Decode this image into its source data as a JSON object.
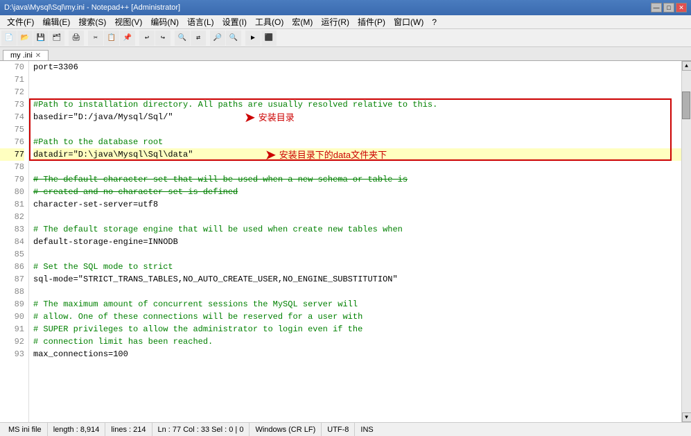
{
  "titlebar": {
    "title": "D:\\java\\Mysql\\Sql\\my.ini - Notepad++ [Administrator]",
    "min_label": "—",
    "max_label": "□",
    "close_label": "✕"
  },
  "menubar": {
    "items": [
      "文件(F)",
      "编辑(E)",
      "搜索(S)",
      "视图(V)",
      "编码(N)",
      "语言(L)",
      "设置(I)",
      "工具(O)",
      "宏(M)",
      "运行(R)",
      "插件(P)",
      "窗口(W)",
      "?"
    ]
  },
  "tabbar": {
    "tabs": [
      {
        "label": "my .ini",
        "active": true
      }
    ]
  },
  "annotations": {
    "basedir_label": "安装目录",
    "datadir_label": "安装目录下的data文件夹下"
  },
  "statusbar": {
    "filetype": "MS ini file",
    "length": "length : 8,914",
    "lines": "lines : 214",
    "position": "Ln : 77   Col : 33   Sel : 0 | 0",
    "eol": "Windows (CR LF)",
    "encoding": "UTF-8",
    "ins": "INS"
  },
  "lines": [
    {
      "num": "70",
      "content": "port=3306",
      "type": "normal"
    },
    {
      "num": "71",
      "content": "",
      "type": "normal"
    },
    {
      "num": "72",
      "content": "",
      "type": "normal"
    },
    {
      "num": "73",
      "content": "#Path to installation directory. All paths are usually resolved relative to this.",
      "type": "comment"
    },
    {
      "num": "74",
      "content": "basedir=\"D:/java/Mysql/Sql/\"",
      "type": "normal"
    },
    {
      "num": "75",
      "content": "",
      "type": "normal"
    },
    {
      "num": "76",
      "content": "#Path to the database root",
      "type": "comment"
    },
    {
      "num": "77",
      "content": "datadir=\"D:\\java\\Mysql\\Sql\\data\"",
      "type": "current"
    },
    {
      "num": "78",
      "content": "",
      "type": "normal"
    },
    {
      "num": "79",
      "content": "# The default character set that will be used when a new schema or table is",
      "type": "comment-struck"
    },
    {
      "num": "80",
      "content": "# created and no character set is defined",
      "type": "comment-struck"
    },
    {
      "num": "81",
      "content": "character-set-server=utf8",
      "type": "normal"
    },
    {
      "num": "82",
      "content": "",
      "type": "normal"
    },
    {
      "num": "83",
      "content": "# The default storage engine that will be used when create new tables when",
      "type": "comment"
    },
    {
      "num": "84",
      "content": "default-storage-engine=INNODB",
      "type": "normal"
    },
    {
      "num": "85",
      "content": "",
      "type": "normal"
    },
    {
      "num": "86",
      "content": "# Set the SQL mode to strict",
      "type": "comment"
    },
    {
      "num": "87",
      "content": "sql-mode=\"STRICT_TRANS_TABLES,NO_AUTO_CREATE_USER,NO_ENGINE_SUBSTITUTION\"",
      "type": "normal"
    },
    {
      "num": "88",
      "content": "",
      "type": "normal"
    },
    {
      "num": "89",
      "content": "# The maximum amount of concurrent sessions the MySQL server will",
      "type": "comment"
    },
    {
      "num": "90",
      "content": "# allow. One of these connections will be reserved for a user with",
      "type": "comment"
    },
    {
      "num": "91",
      "content": "# SUPER privileges to allow the administrator to login even if the",
      "type": "comment"
    },
    {
      "num": "92",
      "content": "# connection limit has been reached.",
      "type": "comment"
    },
    {
      "num": "93",
      "content": "max_connections=100",
      "type": "normal"
    }
  ]
}
